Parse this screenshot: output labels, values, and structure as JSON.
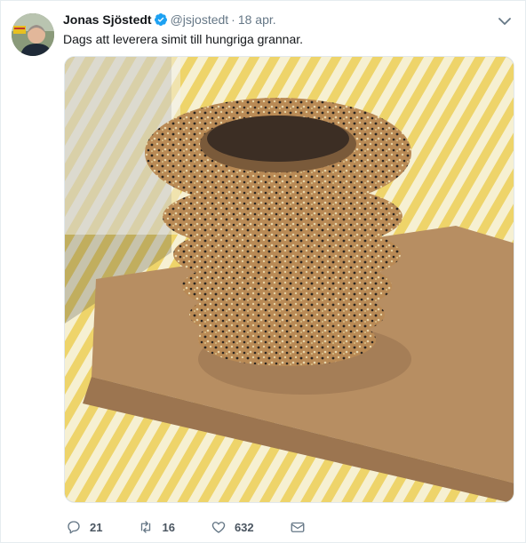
{
  "tweet": {
    "author_name": "Jonas Sjöstedt",
    "handle": "@jsjostedt",
    "separator": "·",
    "date": "18 apr.",
    "text": "Dags att leverera simit till hungriga grannar."
  },
  "actions": {
    "replies": "21",
    "retweets": "16",
    "likes": "632"
  },
  "icons": {
    "verified": "verified-badge-icon",
    "menu": "chevron-down-icon",
    "reply": "reply-icon",
    "retweet": "retweet-icon",
    "like": "heart-icon",
    "share": "share-icon"
  },
  "colors": {
    "verified": "#1da1f2",
    "secondary_text": "#657786",
    "border": "#e6ecf0"
  }
}
